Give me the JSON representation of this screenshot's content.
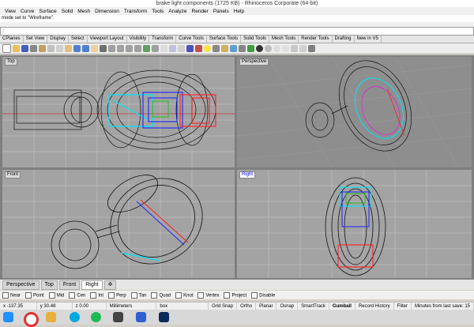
{
  "window": {
    "title": "brake light components (1725 KB) - Rhinoceros Corporate (64-bit)"
  },
  "menu": [
    "View",
    "Curve",
    "Surface",
    "Solid",
    "Mesh",
    "Dimension",
    "Transform",
    "Tools",
    "Analyze",
    "Render",
    "Panels",
    "Help"
  ],
  "command_history": "mode set to \"Wireframe\".",
  "command_prompt": ":",
  "toolbar_tabs": [
    "CPlanes",
    "Set View",
    "Display",
    "Select",
    "Viewport Layout",
    "Visibility",
    "Transform",
    "Curve Tools",
    "Surface Tools",
    "Solid Tools",
    "Mesh Tools",
    "Render Tools",
    "Drafting",
    "New in V5"
  ],
  "viewports": {
    "top": "Top",
    "perspective": "Perspective",
    "front": "Front",
    "right": "Right"
  },
  "viewport_tabs": [
    "Perspective",
    "Top",
    "Front",
    "Right"
  ],
  "active_viewport_tab": "Right",
  "osnap": [
    "Near",
    "Point",
    "Mid",
    "Cen",
    "Int",
    "Perp",
    "Tan",
    "Quad",
    "Knot",
    "Vertex",
    "Project",
    "Disable"
  ],
  "status": {
    "x": "x -137.35",
    "y": "y 30.48",
    "z": "z 0.00",
    "units": "Millimeters",
    "layer": "box",
    "grid_snap": "Grid Snap",
    "ortho": "Ortho",
    "planar": "Planar",
    "osnap": "Osnap",
    "smarttrack": "SmartTrack",
    "gumball": "Gumball",
    "record_history": "Record History",
    "filter": "Filter",
    "autosave": "Minutes from last save: 15"
  },
  "colors": {
    "wire": "#111111",
    "cyan": "#00e5ff",
    "blue": "#2020ff",
    "red": "#ff2020",
    "green": "#20c020",
    "magenta": "#e020e0"
  }
}
